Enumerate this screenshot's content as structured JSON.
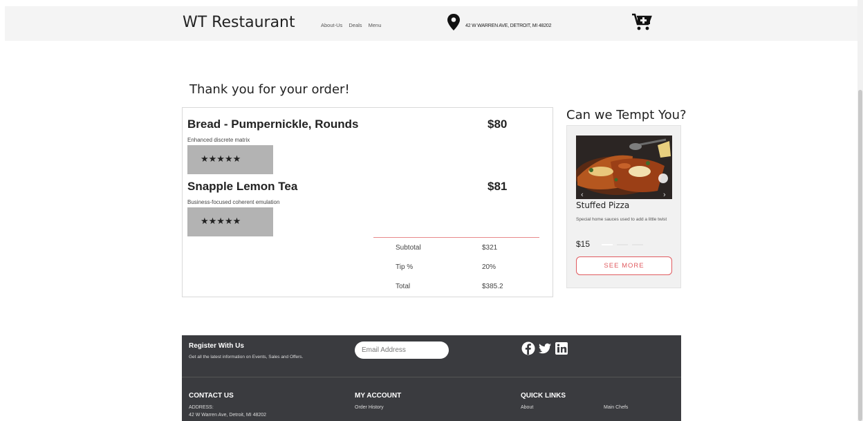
{
  "header": {
    "brand": "WT Restaurant",
    "nav": [
      "About-Us",
      "Deals",
      "Menu"
    ],
    "address": "42 W WARREN AVE, DETROIT, MI 48202",
    "icons": [
      "location-pin-icon",
      "cart-plus-icon"
    ]
  },
  "order": {
    "heading": "Thank you for your order!",
    "items": [
      {
        "name": "Bread - Pumpernickle, Rounds",
        "price": "$80",
        "description": "Enhanced discrete matrix",
        "stars": "★★★★★",
        "rating": 5
      },
      {
        "name": "Snapple Lemon Tea",
        "price": "$81",
        "description": "Business-focused coherent emulation",
        "stars": "★★★★★",
        "rating": 5
      }
    ],
    "summary": {
      "subtotal_label": "Subtotal",
      "subtotal_value": "$321",
      "tip_label": "Tip %",
      "tip_value": "20%",
      "total_label": "Total",
      "total_value": "$385.2"
    }
  },
  "promo": {
    "heading": "Can we Tempt You?",
    "name": "Stuffed Pizza",
    "description": "Special home sauces used to add a little twist",
    "price": "$15",
    "button": "SEE MORE",
    "carousel_arrows": [
      "‹",
      "›"
    ]
  },
  "footer": {
    "register_title": "Register With Us",
    "register_sub": "Get all the latest information on Events, Sales and Offers.",
    "email_placeholder": "Email Address",
    "social_icons": [
      "facebook-icon",
      "twitter-icon",
      "linkedin-icon"
    ],
    "contact_title": "CONTACT US",
    "address_label": "ADDRESS:",
    "address_value": "42 W Warren Ave, Detroit, MI 48202",
    "account_title": "MY ACCOUNT",
    "account_link": "Order History",
    "quick_title": "QUICK LINKS",
    "quick_links": [
      "About",
      "Main Chefs"
    ]
  },
  "colors": {
    "accent": "#e05a5f",
    "footer_bg": "#3a3b3f",
    "header_bg": "#f4f4f4"
  }
}
